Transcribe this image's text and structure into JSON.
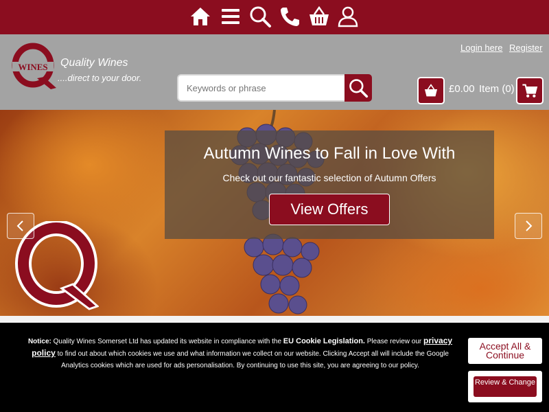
{
  "topbar": {
    "icons": [
      "home-icon",
      "menu-icon",
      "search-icon",
      "phone-icon",
      "basket-icon",
      "account-icon"
    ]
  },
  "header": {
    "logo_text": "WINES",
    "tagline": "Quality Wines",
    "subtagline": "....direct to your door.",
    "login": "Login here",
    "register": "Register"
  },
  "search": {
    "placeholder": "Keywords or phrase"
  },
  "cart": {
    "total": "£0.00",
    "items": "Item (0)"
  },
  "hero": {
    "title": "Autumn Wines to Fall in Love With",
    "subtitle": "Check out our fantastic selection of Autumn Offers",
    "cta": "View Offers"
  },
  "cookie": {
    "notice_label": "Notice:",
    "text1": "Quality Wines Somerset Ltd has updated its website in compliance with the",
    "eu_label": "EU Cookie Legislation.",
    "text2": "Please review our",
    "privacy_label": "privacy policy",
    "text3": "to find out about which cookies we use and what information we collect on our website. Clicking Accept all will include the Google Analytics cookies which are used for ads personalisation. By continuing to use this site, you are agreeing to our policy.",
    "accept_label": "Accept All & Continue",
    "review_label": "Review & Change"
  },
  "colors": {
    "brand": "#8b0d1f",
    "header_bg": "#a3a3a3",
    "cookie_bg": "#000000"
  }
}
